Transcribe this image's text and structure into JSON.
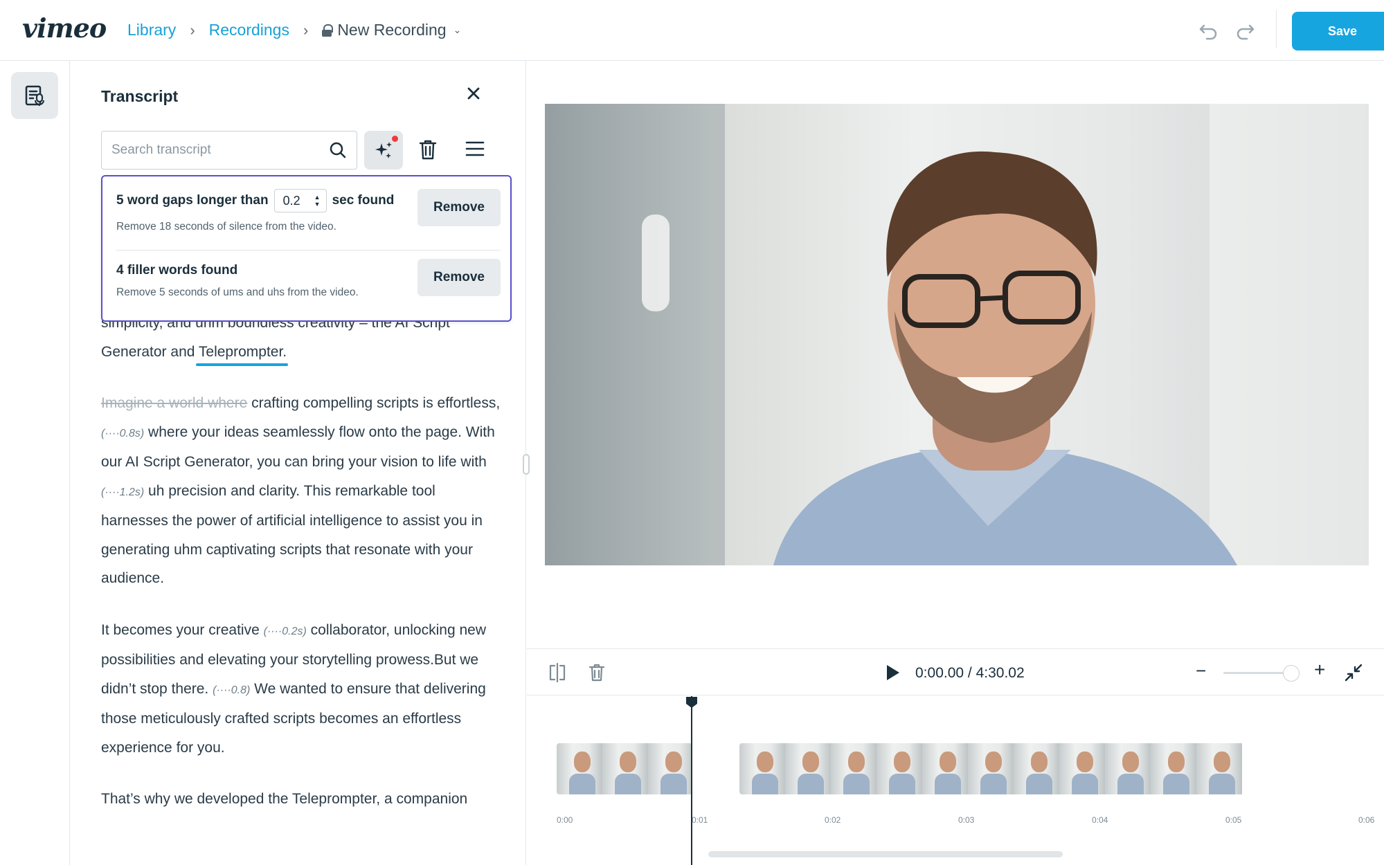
{
  "header": {
    "logo": "vimeo",
    "breadcrumbs": [
      "Library",
      "Recordings"
    ],
    "current": "New Recording",
    "save_label": "Save"
  },
  "panel": {
    "title": "Transcript",
    "search_placeholder": "Search transcript"
  },
  "suggestions": {
    "gaps_prefix": "5 word gaps longer than",
    "gaps_value": "0.2",
    "gaps_suffix": "sec found",
    "gaps_sub": "Remove 18 seconds of silence from the video.",
    "filler_title": "4 filler words found",
    "filler_sub": "Remove 5 seconds of ums and uhs from the video.",
    "remove_label": "Remove"
  },
  "transcript": {
    "p1_hidden": "simplicity, and uhm boundless creativity – the AI Script",
    "p1_a": "Generator and ",
    "p1_highlight": "Teleprompter.",
    "p2_struck": "Imagine a world where",
    "p2_a": " crafting compelling scripts is effortless, ",
    "gap1": "(····0.8s)",
    "p2_b": " where your ideas seamlessly flow onto the page. With our AI Script Generator, you can bring your vision to life with ",
    "gap2": "(····1.2s)",
    "p2_c": " uh precision and clarity. This remarkable tool harnesses the power of artificial intelligence to assist you in generating uhm captivating scripts that resonate with your audience.",
    "p3_a": "It becomes your creative ",
    "gap3": "(····0.2s)",
    "p3_b": " collaborator, unlocking new possibilities and elevating your storytelling prowess.But we didn’t stop there. ",
    "gap4": "(····0.8)",
    "p3_c": " We wanted to ensure that delivering those meticulously crafted scripts becomes an effortless experience for you.",
    "p4": "That’s why we developed the Teleprompter, a companion"
  },
  "player": {
    "time": "0:00.00 / 4:30.02",
    "zoom_level": 0.9
  },
  "timeline": {
    "ticks": [
      "0:00",
      "0:01",
      "0:02",
      "0:03",
      "0:04",
      "0:05",
      "0:06"
    ]
  }
}
